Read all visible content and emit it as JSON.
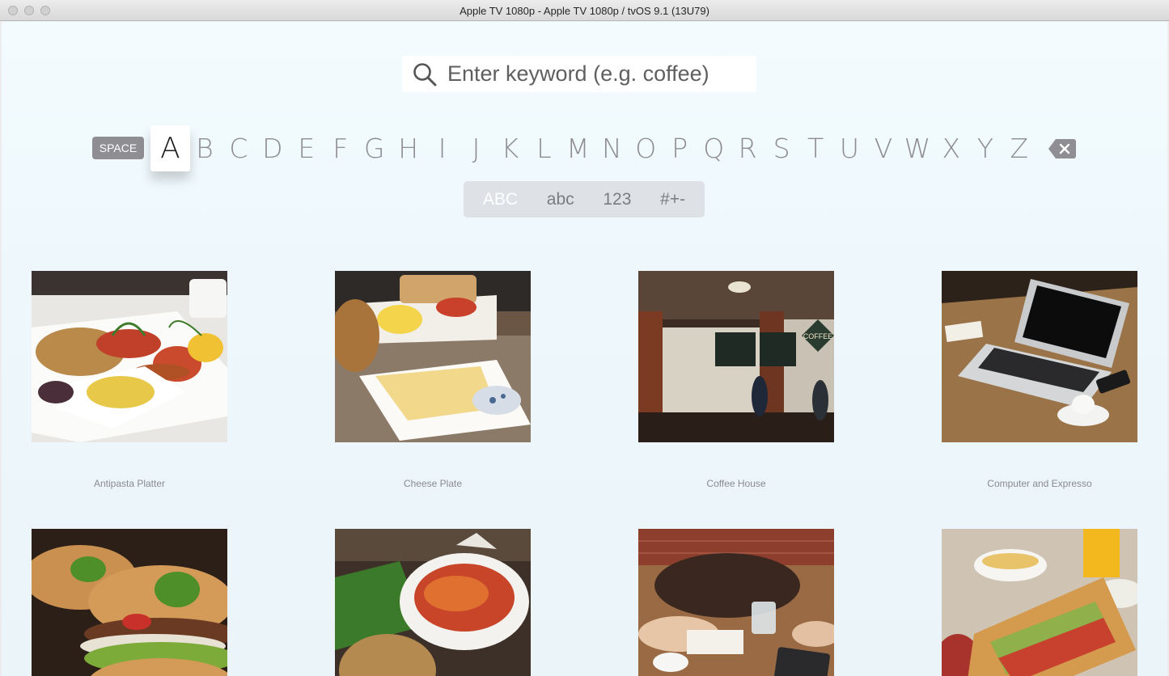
{
  "window": {
    "title": "Apple TV 1080p - Apple TV 1080p / tvOS 9.1 (13U79)"
  },
  "search": {
    "placeholder": "Enter keyword (e.g. coffee)"
  },
  "keyboard": {
    "space_label": "SPACE",
    "letters": [
      "A",
      "B",
      "C",
      "D",
      "E",
      "F",
      "G",
      "H",
      "I",
      "J",
      "K",
      "L",
      "M",
      "N",
      "O",
      "P",
      "Q",
      "R",
      "S",
      "T",
      "U",
      "V",
      "W",
      "X",
      "Y",
      "Z"
    ],
    "focused_letter": "A",
    "modes": [
      "ABC",
      "abc",
      "123",
      "#+-"
    ],
    "active_mode": "ABC"
  },
  "results": [
    {
      "caption": "Antipasta Platter",
      "icon": "antipasta-platter-photo"
    },
    {
      "caption": "Cheese Plate",
      "icon": "cheese-plate-photo"
    },
    {
      "caption": "Coffee House",
      "icon": "coffee-house-photo",
      "sign_text": "COFFEE"
    },
    {
      "caption": "Computer and Expresso",
      "icon": "laptop-espresso-photo"
    },
    {
      "caption": "",
      "icon": "burger-photo"
    },
    {
      "caption": "",
      "icon": "pasta-bowl-photo"
    },
    {
      "caption": "",
      "icon": "meeting-table-photo"
    },
    {
      "caption": "",
      "icon": "sandwich-soup-photo"
    }
  ],
  "colors": {
    "screen_bg": "#eef8fc",
    "key_gray": "#8d8d92",
    "focus_bg": "#ffffff",
    "mode_bar_bg": "#dee2e6"
  }
}
